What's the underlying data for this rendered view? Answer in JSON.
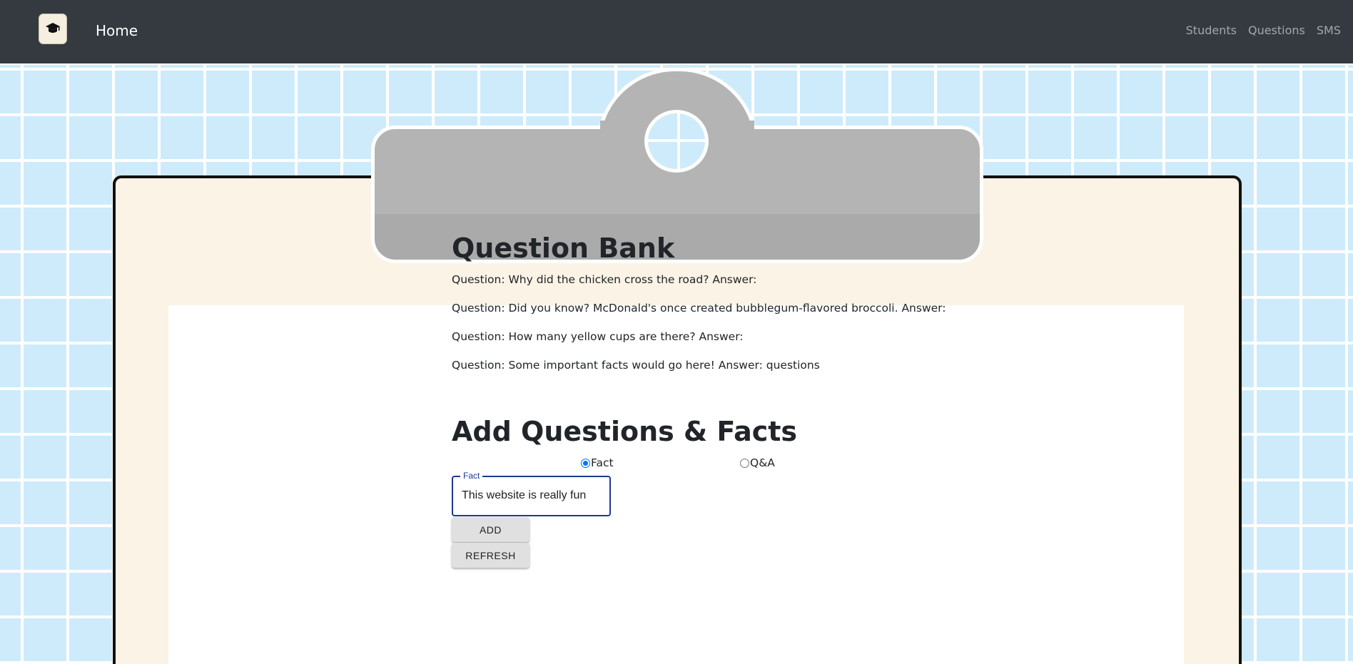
{
  "nav": {
    "logo_icon": "graduation-cap-icon",
    "home": "Home",
    "links": [
      "Students",
      "Questions",
      "SMS"
    ]
  },
  "question_bank": {
    "title": "Question Bank",
    "items": [
      "Question: Why did the chicken cross the road? Answer:",
      "Question: Did you know? McDonald's once created bubblegum-flavored broccoli. Answer:",
      "Question: How many yellow cups are there? Answer:",
      "Question: Some important facts would go here! Answer: questions"
    ]
  },
  "add_form": {
    "title": "Add Questions & Facts",
    "radio_fact_label": "Fact",
    "radio_qa_label": "Q&A",
    "selected": "Fact",
    "fact_field_label": "Fact",
    "fact_field_value": "This website is really fun",
    "add_button": "ADD",
    "refresh_button": "REFRESH"
  },
  "colors": {
    "navbar": "#343a40",
    "background": "#cdebfb",
    "board": "#fbf3e5",
    "clip": "#b4b4b4",
    "accent": "#1f3a93"
  }
}
